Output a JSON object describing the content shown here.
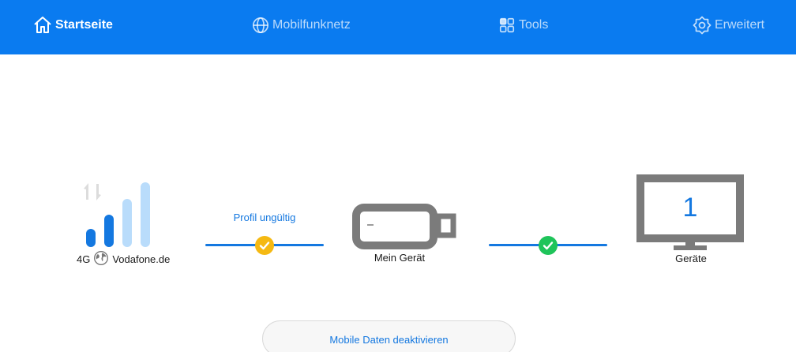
{
  "nav": {
    "home": "Startseite",
    "mobile": "Mobilfunknetz",
    "tools": "Tools",
    "advanced": "Erweitert"
  },
  "status": {
    "network_type": "4G",
    "provider": "Vodafone.de",
    "signal_strength_bars": 2,
    "signal_total_bars": 4,
    "profile_status": "Profil ungültig",
    "device_label": "Mein Gerät",
    "connected_devices_count": "1",
    "connected_devices_label": "Geräte"
  },
  "actions": {
    "toggle_mobile_data": "Mobile Daten deaktivieren"
  },
  "icons": {
    "home": "home-icon",
    "mobile": "globe-icon",
    "tools": "grid-icon",
    "advanced": "gear-icon",
    "transfer": "transfer-arrows-icon",
    "roaming": "globe-icon",
    "profile_check": "check-circle-icon",
    "connection_check": "check-circle-icon",
    "device": "usb-stick-icon",
    "monitor": "monitor-icon"
  },
  "colors": {
    "header_bg": "#0a7bf0",
    "accent": "#1478e0",
    "warning": "#f5b912",
    "success": "#1fc45a",
    "signal_active": "#1478e0",
    "signal_inactive": "#b9dcfb",
    "device_gray": "#7b7b7b"
  }
}
